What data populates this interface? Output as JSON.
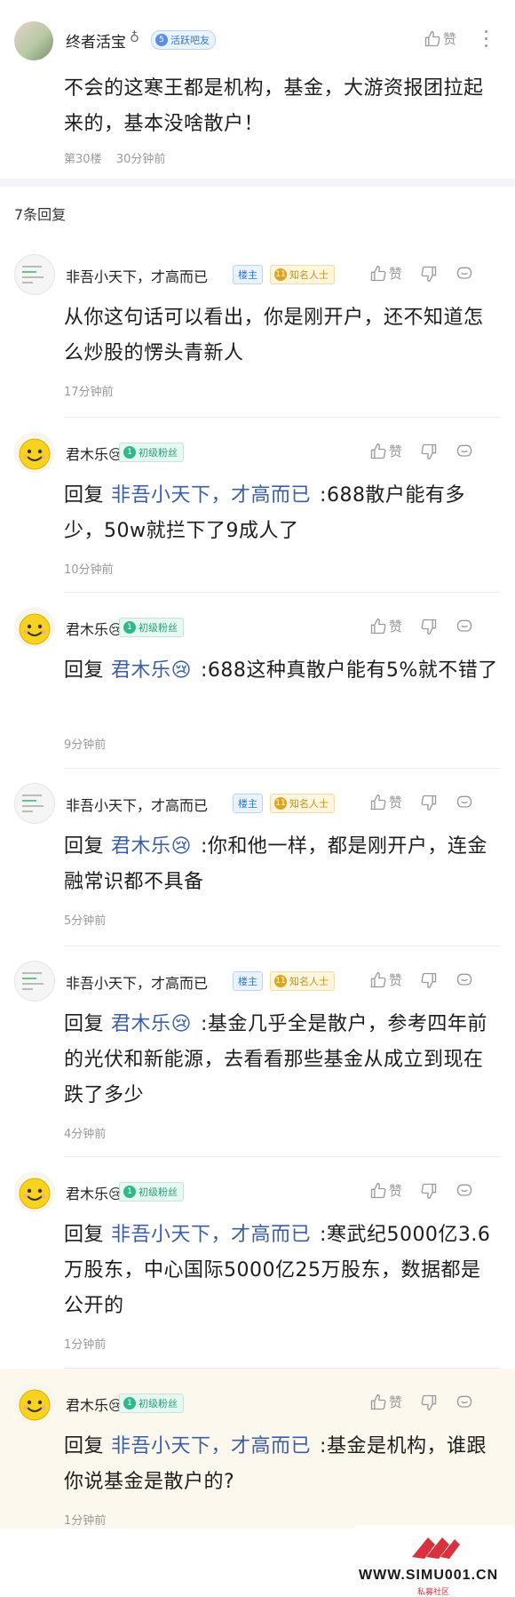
{
  "top_post": {
    "username": "终者活宝",
    "gender_symbol": "♁",
    "level": "5",
    "badge": "活跃吧友",
    "like_label": "赞",
    "text": "不会的这寒王都是机构，基金，大游资报团拉起来的，基本没啥散户！",
    "floor": "第30楼",
    "time": "30分钟前"
  },
  "reply_count": "7条回复",
  "replies": [
    {
      "username": "非吾小天下，才高而已",
      "owner_badge": "楼主",
      "level": "11",
      "badge": "知名人士",
      "like_label": "赞",
      "text": "从你这句话可以看出，你是刚开户，还不知道怎么炒股的愣头青新人",
      "time": "17分钟前"
    },
    {
      "username": "君木乐😢",
      "level": "1",
      "badge": "初级粉丝",
      "like_label": "赞",
      "prefix": "回复",
      "reply_to": "非吾小天下，才高而已",
      "text": ":688散户能有多少，50w就拦下了9成人了",
      "time": "10分钟前"
    },
    {
      "username": "君木乐😢",
      "level": "1",
      "badge": "初级粉丝",
      "like_label": "赞",
      "prefix": "回复",
      "reply_to": "君木乐😢",
      "text": ":688这种真散户能有5%就不错了",
      "time": "9分钟前"
    },
    {
      "username": "非吾小天下，才高而已",
      "owner_badge": "楼主",
      "level": "11",
      "badge": "知名人士",
      "like_label": "赞",
      "prefix": "回复",
      "reply_to": "君木乐😢",
      "text": ":你和他一样，都是刚开户，连金融常识都不具备",
      "time": "5分钟前"
    },
    {
      "username": "非吾小天下，才高而已",
      "owner_badge": "楼主",
      "level": "11",
      "badge": "知名人士",
      "like_label": "赞",
      "prefix": "回复",
      "reply_to": "君木乐😢",
      "text": ":基金几乎全是散户，参考四年前的光伏和新能源，去看看那些基金从成立到现在跌了多少",
      "time": "4分钟前"
    },
    {
      "username": "君木乐😢",
      "level": "1",
      "badge": "初级粉丝",
      "like_label": "赞",
      "prefix": "回复",
      "reply_to": "非吾小天下，才高而已",
      "text": ":寒武纪5000亿3.6万股东，中心国际5000亿25万股东，数据都是公开的",
      "time": "1分钟前"
    },
    {
      "username": "君木乐😢",
      "level": "1",
      "badge": "初级粉丝",
      "like_label": "赞",
      "prefix": "回复",
      "reply_to": "非吾小天下，才高而已",
      "text": ":基金是机构，谁跟你说基金是散户的?",
      "time": "1分钟前"
    }
  ],
  "watermark": {
    "site": "WWW.SIMU001.CN",
    "tagline": "私募社区"
  },
  "colors": {
    "link": "#3b5ea8",
    "highlight_bg": "#fdf8ee",
    "section_gap": "#f3f4f8"
  }
}
